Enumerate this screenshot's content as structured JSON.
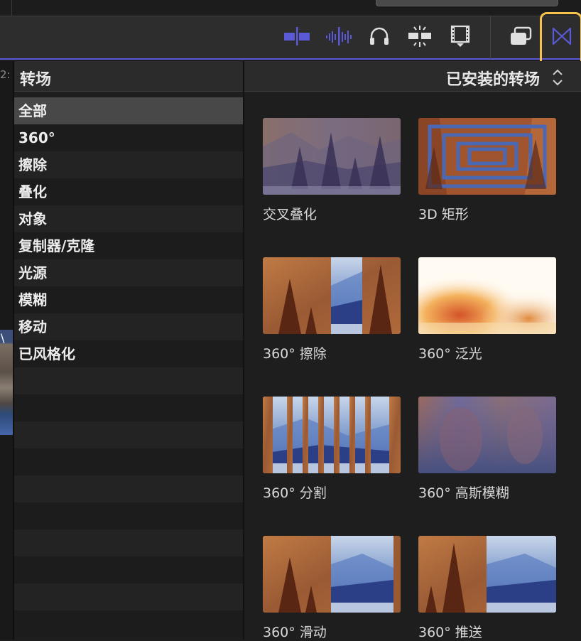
{
  "timeline": {
    "timecode_fragment": "2:"
  },
  "toolbar": {
    "buttons": [
      {
        "icon": "clip-skimming-icon"
      },
      {
        "icon": "audio-skimming-icon"
      },
      {
        "icon": "headphones-icon"
      },
      {
        "icon": "snapping-icon"
      },
      {
        "icon": "effects-browser-icon"
      },
      {
        "icon": "photos-audio-icon"
      },
      {
        "icon": "transitions-browser-icon",
        "active": true
      }
    ],
    "accent_color": "#5a5ad6",
    "highlight_color": "#f5c24e"
  },
  "sidebar": {
    "title": "转场",
    "items": [
      {
        "label": "全部",
        "selected": true
      },
      {
        "label": "360°"
      },
      {
        "label": "擦除"
      },
      {
        "label": "叠化"
      },
      {
        "label": "对象"
      },
      {
        "label": "复制器/克隆"
      },
      {
        "label": "光源"
      },
      {
        "label": "模糊"
      },
      {
        "label": "移动"
      },
      {
        "label": "已风格化"
      }
    ]
  },
  "browser": {
    "title": "已安装的转场",
    "transitions": [
      {
        "label": "交叉叠化",
        "thumb": "cross-dissolve"
      },
      {
        "label": "3D 矩形",
        "thumb": "3d-rectangle"
      },
      {
        "label": "360° 擦除",
        "thumb": "360-wipe"
      },
      {
        "label": "360° 泛光",
        "thumb": "360-bloom"
      },
      {
        "label": "360° 分割",
        "thumb": "360-split"
      },
      {
        "label": "360° 高斯模糊",
        "thumb": "360-gaussian-blur"
      },
      {
        "label": "360° 滑动",
        "thumb": "360-slide"
      },
      {
        "label": "360° 推送",
        "thumb": "360-push"
      }
    ]
  }
}
